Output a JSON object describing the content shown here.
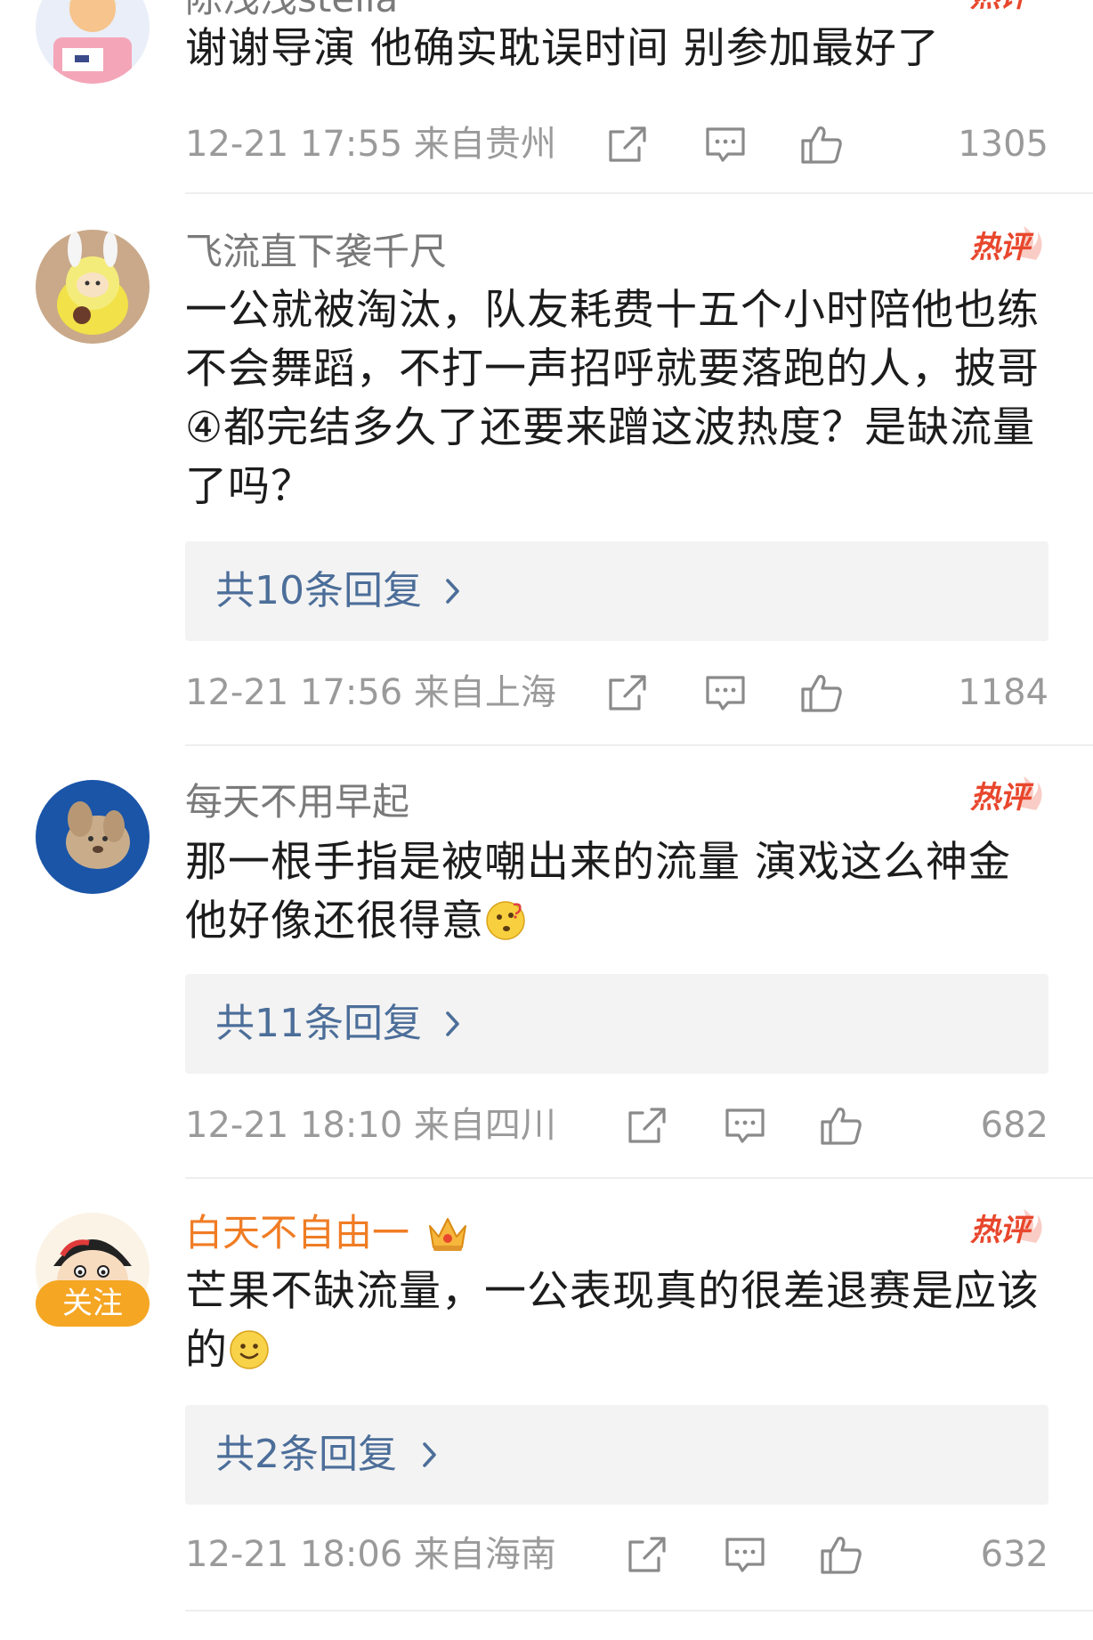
{
  "hot_badge_label": "热评",
  "comments": [
    {
      "username": "陈浅浅stella",
      "content": "谢谢导演 他确实耽误时间 别参加最好了",
      "time_location": "12-21 17:55 来自贵州",
      "likes": "1305",
      "hot": true
    },
    {
      "username": "飞流直下袭千尺",
      "content": "一公就被淘汰，队友耗费十五个小时陪他也练不会舞蹈，不打一声招呼就要落跑的人，披哥④都完结多久了还要来蹭这波热度？是缺流量了吗？",
      "replies": "共10条回复",
      "time_location": "12-21 17:56 来自上海",
      "likes": "1184",
      "hot": true
    },
    {
      "username": "每天不用早起",
      "content": "那一根手指是被嘲出来的流量 演戏这么神金 他好像还很得意",
      "emoji": "thinking-face",
      "replies": "共11条回复",
      "time_location": "12-21 18:10 来自四川",
      "likes": "682",
      "hot": true
    },
    {
      "username": "白天不自由一",
      "content": "芒果不缺流量，一公表现真的很差退赛是应该的",
      "emoji": "smile-face",
      "follow_label": "关注",
      "replies": "共2条回复",
      "time_location": "12-21 18:06 来自海南",
      "likes": "632",
      "hot": true,
      "vip": true
    }
  ],
  "colors": {
    "username": "#7a7a7a",
    "vip_username": "#f07c24",
    "reply_link": "#4c6e99",
    "hot_badge": "#e8472d",
    "meta": "#9a9a9a",
    "follow_badge": "#f5a623"
  }
}
